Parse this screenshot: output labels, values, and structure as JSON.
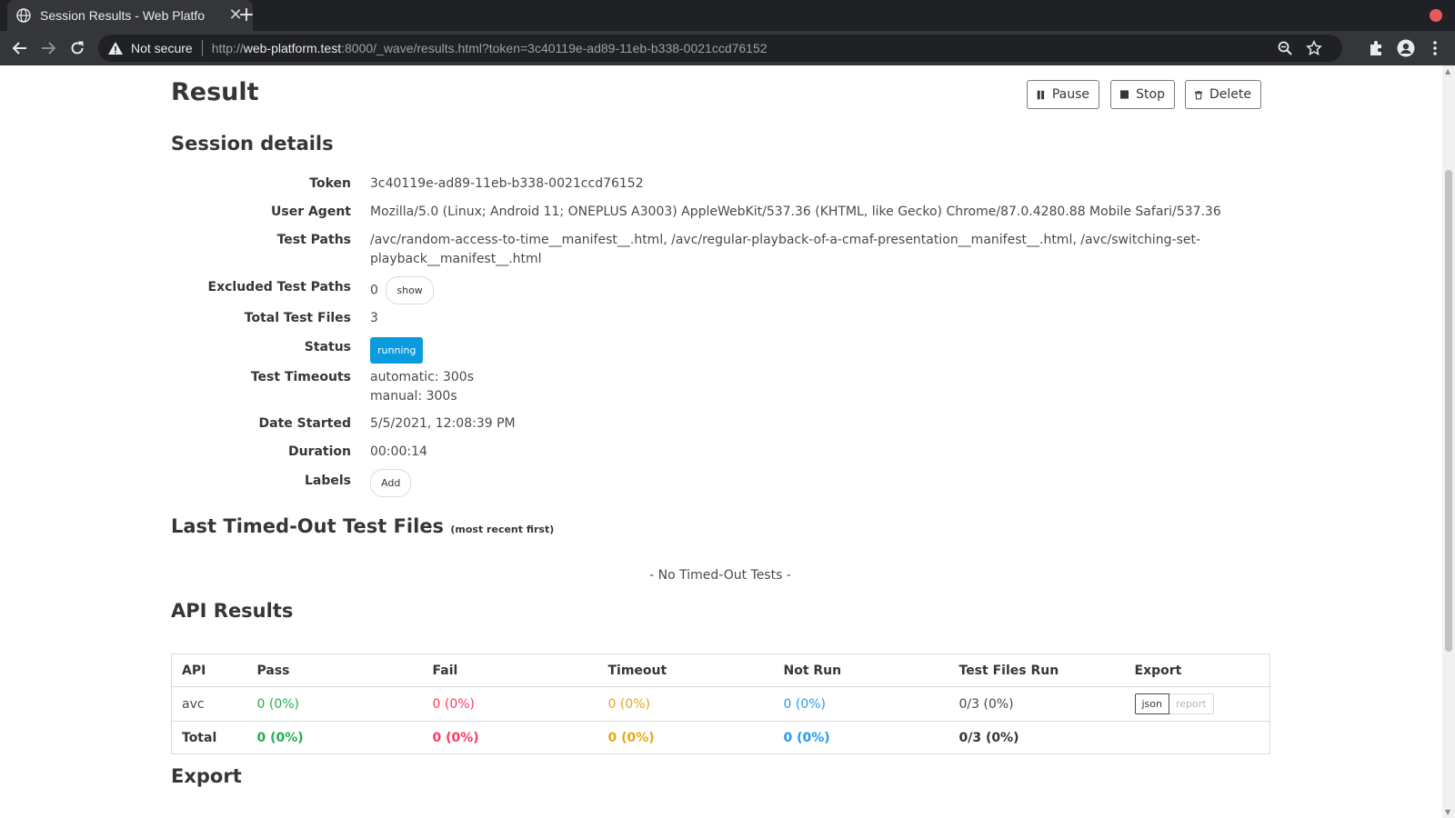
{
  "browser": {
    "tab_title": "Session Results - Web Platfo",
    "tab_close": "✕",
    "new_tab": "+",
    "security_label": "Not secure",
    "url_scheme": "http://",
    "url_host": "web-platform.test",
    "url_rest": ":8000/_wave/results.html?token=3c40119e-ad89-11eb-b338-0021ccd76152"
  },
  "page": {
    "title": "Result",
    "actions": {
      "pause": "Pause",
      "stop": "Stop",
      "delete": "Delete"
    }
  },
  "session": {
    "heading": "Session details",
    "token_label": "Token",
    "token": "3c40119e-ad89-11eb-b338-0021ccd76152",
    "ua_label": "User Agent",
    "user_agent": "Mozilla/5.0 (Linux; Android 11; ONEPLUS A3003) AppleWebKit/537.36 (KHTML, like Gecko) Chrome/87.0.4280.88 Mobile Safari/537.36",
    "paths_label": "Test Paths",
    "test_paths_line1": "/avc/random-access-to-time__manifest__.html, /avc/regular-playback-of-a-cmaf-presentation__manifest__.html, /avc/switching-set-",
    "test_paths_line2": "playback__manifest__.html",
    "excluded_label": "Excluded Test Paths",
    "excluded_count": "0",
    "show_button": "show",
    "total_label": "Total Test Files",
    "total_files": "3",
    "status_label": "Status",
    "status": "running",
    "timeouts_label": "Test Timeouts",
    "timeout_automatic": "automatic: 300s",
    "timeout_manual": "manual: 300s",
    "date_label": "Date Started",
    "date_started": "5/5/2021, 12:08:39 PM",
    "duration_label": "Duration",
    "duration": "00:00:14",
    "labels_label": "Labels",
    "add_button": "Add"
  },
  "timed_out": {
    "heading": "Last Timed-Out Test Files",
    "heading_note": "(most recent first)",
    "empty_text": "- No Timed-Out Tests -"
  },
  "api_results": {
    "heading": "API Results",
    "columns": [
      "API",
      "Pass",
      "Fail",
      "Timeout",
      "Not Run",
      "Test Files Run",
      "Export"
    ],
    "rows": [
      {
        "api": "avc",
        "pass": "0 (0%)",
        "fail": "0 (0%)",
        "timeout": "0 (0%)",
        "not_run": "0 (0%)",
        "files_run": "0/3 (0%)",
        "export_json": "json",
        "export_report": "report"
      }
    ],
    "total": {
      "api": "Total",
      "pass": "0 (0%)",
      "fail": "0 (0%)",
      "timeout": "0 (0%)",
      "not_run": "0 (0%)",
      "files_run": "0/3 (0%)"
    }
  },
  "export": {
    "heading": "Export"
  },
  "colors": {
    "pass": "#22b14c",
    "fail": "#ff3860",
    "timeout": "#e6a817",
    "not_run": "#209cee",
    "status": "#0a9ade"
  }
}
